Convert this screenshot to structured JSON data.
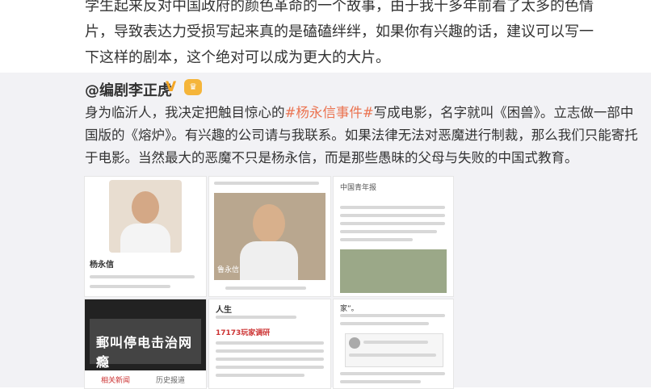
{
  "top_text": {
    "line1": "学生起来反对中国政府的颜色革命的一个故事，由于我十多年前看了太多的色情",
    "line2": "片，导致表达力受损写起来真的是磕磕绊绊，如果你有兴趣的话，建议可以写一",
    "line3": "下这样的剧本，这个绝对可以成为更大的大片。"
  },
  "repost": {
    "author": "@编剧李正虎",
    "verified_icon": "v-verified-icon",
    "badge_icon": "crown-badge-icon",
    "text_part1": "身为临沂人，我决定把触目惊心的",
    "hashtag": "#杨永信事件#",
    "text_part2": "写成电影，名字就叫《困兽》。立志做一部中国版的《熔炉》。有兴趣的公司请与我联系。如果法律无法对恶魔进行制裁，那么我们只能寄托于电影。当然最大的恶魔不只是杨永信，而是那些愚昧的父母与失败的中国式教育。",
    "tag_color": "#eb7350"
  },
  "thumbnails": {
    "t1_name": "杨永信",
    "t2_caption": "鲁永信",
    "t3_heading": "中国青年报",
    "t4_banner": "郵叫停电击治网瘾",
    "t4_link": "相关新闻",
    "t4_link2": "历史报道",
    "t5_title": "人生",
    "t5_highlight": "17173玩家调研",
    "t6_text": "家”。"
  }
}
